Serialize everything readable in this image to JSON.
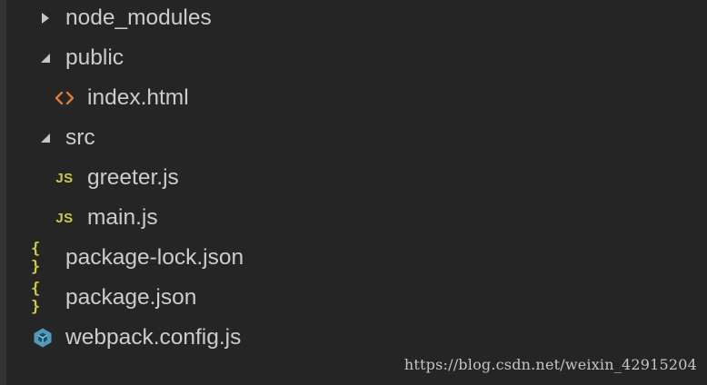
{
  "explorer": {
    "items": [
      {
        "label": "node_modules",
        "kind": "folder",
        "state": "collapsed",
        "icon": "chevron-right-icon"
      },
      {
        "label": "public",
        "kind": "folder",
        "state": "expanded",
        "icon": "chevron-down-icon"
      },
      {
        "label": "index.html",
        "kind": "file",
        "icon": "html-file-icon"
      },
      {
        "label": "src",
        "kind": "folder",
        "state": "expanded",
        "icon": "chevron-down-icon"
      },
      {
        "label": "greeter.js",
        "kind": "file",
        "icon": "js-file-icon",
        "icon_text": "JS"
      },
      {
        "label": "main.js",
        "kind": "file",
        "icon": "js-file-icon",
        "icon_text": "JS"
      },
      {
        "label": "package-lock.json",
        "kind": "file",
        "icon": "json-file-icon",
        "icon_text": "{ }"
      },
      {
        "label": "package.json",
        "kind": "file",
        "icon": "json-file-icon",
        "icon_text": "{ }"
      },
      {
        "label": "webpack.config.js",
        "kind": "file",
        "icon": "webpack-file-icon"
      }
    ]
  },
  "watermark": "https://blog.csdn.net/weixin_42915204",
  "colors": {
    "background": "#252526",
    "text": "#cccccc",
    "twistie": "#c5c5c5",
    "html_icon": "#e37933",
    "js_icon": "#cbcb41",
    "json_icon": "#cbcb41",
    "webpack_icon": "#519aba"
  }
}
